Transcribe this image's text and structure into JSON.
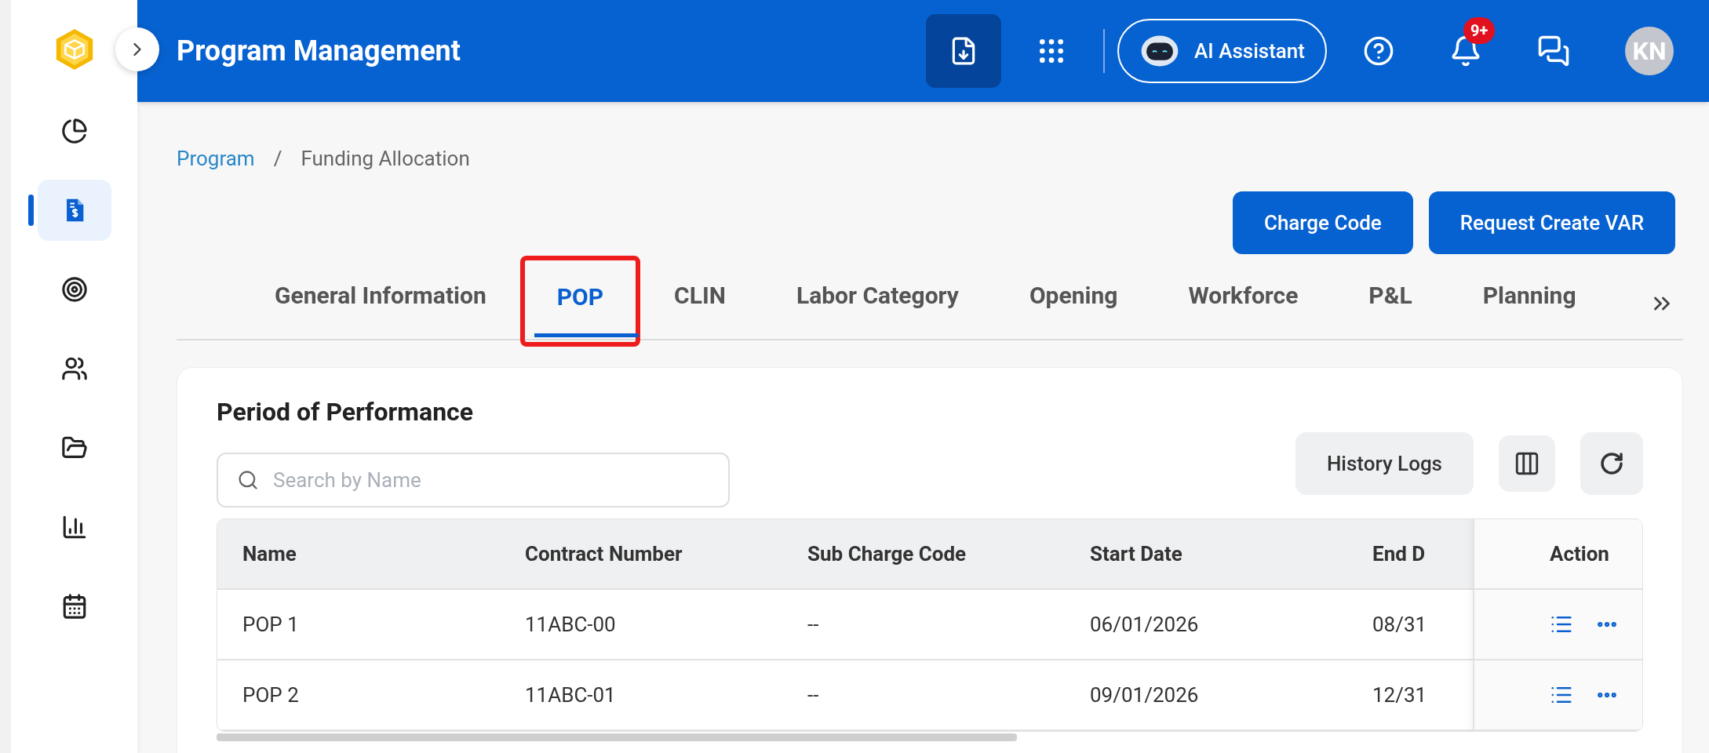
{
  "sidebar": {
    "items": [
      {
        "selected": false
      },
      {
        "selected": true
      },
      {
        "selected": false
      },
      {
        "selected": false
      },
      {
        "selected": false
      },
      {
        "selected": false
      },
      {
        "selected": false
      }
    ]
  },
  "header": {
    "title": "Program Management",
    "ai_button": "AI Assistant",
    "notification_badge": "9+",
    "avatar": "KN"
  },
  "breadcrumb": [
    {
      "label": "Program",
      "link": true
    },
    {
      "label": "/",
      "link": false
    },
    {
      "label": "Funding Allocation",
      "link": false
    }
  ],
  "actions": [
    "Charge Code",
    "Request Create VAR"
  ],
  "tabs": [
    {
      "label": "General Information",
      "selected": false,
      "highlighted": false
    },
    {
      "label": "POP",
      "selected": true,
      "highlighted": true
    },
    {
      "label": "CLIN",
      "selected": false,
      "highlighted": false
    },
    {
      "label": "Labor Category",
      "selected": false,
      "highlighted": false
    },
    {
      "label": "Opening",
      "selected": false,
      "highlighted": false
    },
    {
      "label": "Workforce",
      "selected": false,
      "highlighted": false
    },
    {
      "label": "P&L",
      "selected": false,
      "highlighted": false
    },
    {
      "label": "Planning",
      "selected": false,
      "highlighted": false
    }
  ],
  "card": {
    "title": "Period of Performance",
    "search": {
      "placeholder": "Search by Name"
    },
    "history_button": "History Logs",
    "table": {
      "columns": [
        "Name",
        "Contract Number",
        "Sub Charge Code",
        "Start Date",
        "End D"
      ],
      "action_column": "Action",
      "rows": [
        [
          "POP 1",
          "11ABC-00",
          "--",
          "06/01/2026",
          "08/31"
        ],
        [
          "POP 2",
          "11ABC-01",
          "--",
          "09/01/2026",
          "12/31"
        ]
      ]
    }
  }
}
